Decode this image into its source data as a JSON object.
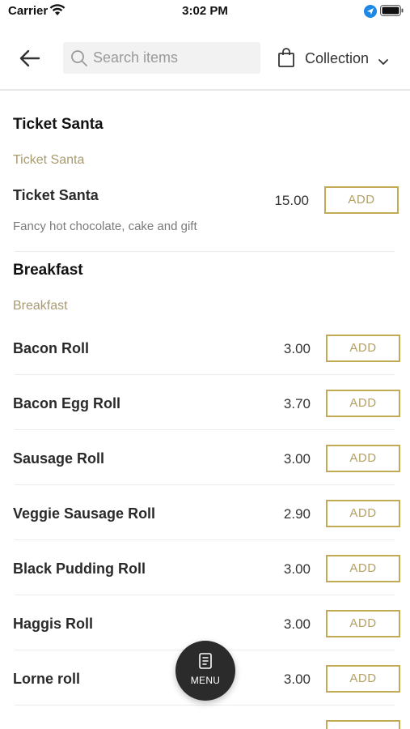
{
  "status_bar": {
    "carrier": "Carrier",
    "time": "3:02 PM"
  },
  "header": {
    "search_placeholder": "Search items",
    "collection_label": "Collection"
  },
  "sections": [
    {
      "title": "Ticket Santa",
      "subtitle": "Ticket Santa",
      "items": [
        {
          "name": "Ticket Santa",
          "description": "Fancy hot chocolate, cake and gift",
          "price": "15.00",
          "add_label": "ADD"
        }
      ]
    },
    {
      "title": "Breakfast",
      "subtitle": "Breakfast",
      "items": [
        {
          "name": "Bacon Roll",
          "price": "3.00",
          "add_label": "ADD"
        },
        {
          "name": "Bacon Egg Roll",
          "price": "3.70",
          "add_label": "ADD"
        },
        {
          "name": "Sausage Roll",
          "price": "3.00",
          "add_label": "ADD"
        },
        {
          "name": "Veggie Sausage Roll",
          "price": "2.90",
          "add_label": "ADD"
        },
        {
          "name": "Black Pudding Roll",
          "price": "3.00",
          "add_label": "ADD"
        },
        {
          "name": "Haggis Roll",
          "price": "3.00",
          "add_label": "ADD"
        },
        {
          "name": "Lorne roll",
          "price": "3.00",
          "add_label": "ADD"
        }
      ]
    }
  ],
  "menu_button": {
    "label": "MENU"
  },
  "colors": {
    "accent_gold": "#c2ab55",
    "subtitle_gold": "#a89b70",
    "fab_background": "#2b2b2b",
    "location_blue": "#1e88e5"
  },
  "icons": [
    "wifi-icon",
    "location-arrow-icon",
    "battery-icon",
    "back-arrow-icon",
    "search-icon",
    "shopping-bag-icon",
    "chevron-down-icon",
    "menu-icon"
  ]
}
